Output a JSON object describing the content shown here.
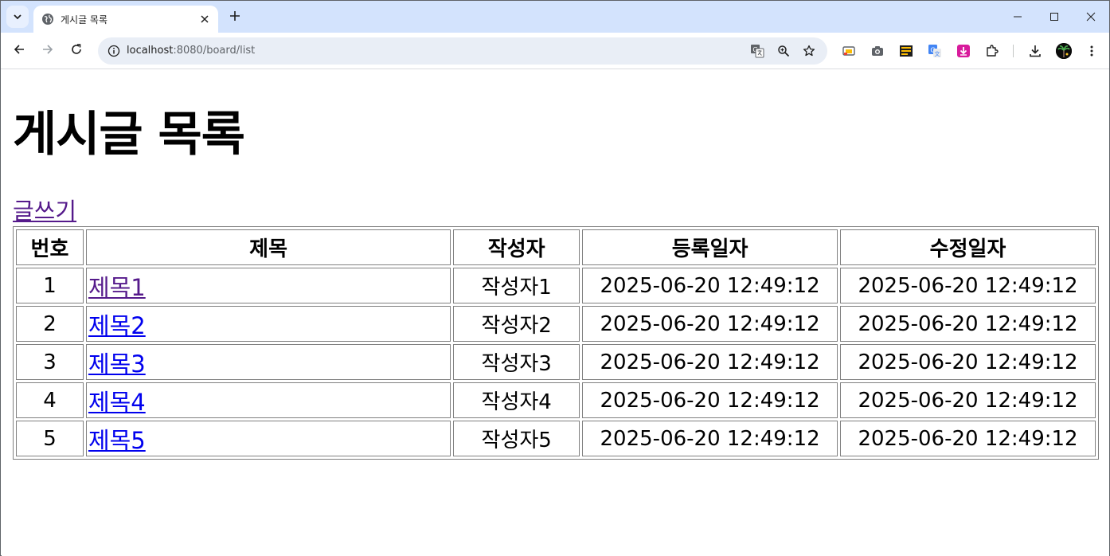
{
  "browser": {
    "tab_title": "게시글 목록",
    "url_host": "localhost",
    "url_rest": ":8080/board/list",
    "icons": {
      "tab_search": "chevron-down-icon",
      "favicon": "globe-icon",
      "tab_close": "close-icon",
      "new_tab": "plus-icon",
      "back": "arrow-left-icon",
      "forward": "arrow-right-icon",
      "reload": "reload-icon",
      "site_info": "info-icon",
      "translate": "translate-icon",
      "zoom": "zoom-icon",
      "bookmark": "star-icon",
      "downloads": "download-icon",
      "menu": "kebab-menu-icon"
    }
  },
  "page": {
    "title": "게시글 목록",
    "write_link": "글쓰기",
    "table": {
      "headers": [
        "번호",
        "제목",
        "작성자",
        "등록일자",
        "수정일자"
      ],
      "rows": [
        {
          "no": "1",
          "title": "제목1",
          "author": "작성자1",
          "created": "2025-06-20 12:49:12",
          "updated": "2025-06-20 12:49:12",
          "visited": true
        },
        {
          "no": "2",
          "title": "제목2",
          "author": "작성자2",
          "created": "2025-06-20 12:49:12",
          "updated": "2025-06-20 12:49:12",
          "visited": false
        },
        {
          "no": "3",
          "title": "제목3",
          "author": "작성자3",
          "created": "2025-06-20 12:49:12",
          "updated": "2025-06-20 12:49:12",
          "visited": false
        },
        {
          "no": "4",
          "title": "제목4",
          "author": "작성자4",
          "created": "2025-06-20 12:49:12",
          "updated": "2025-06-20 12:49:12",
          "visited": false
        },
        {
          "no": "5",
          "title": "제목5",
          "author": "작성자5",
          "created": "2025-06-20 12:49:12",
          "updated": "2025-06-20 12:49:12",
          "visited": false
        }
      ]
    }
  },
  "colors": {
    "tabstrip_bg": "#d3e3fd",
    "link": "#0000ee",
    "visited_link": "#551a8b",
    "omnibox_bg": "#e9eef6"
  }
}
